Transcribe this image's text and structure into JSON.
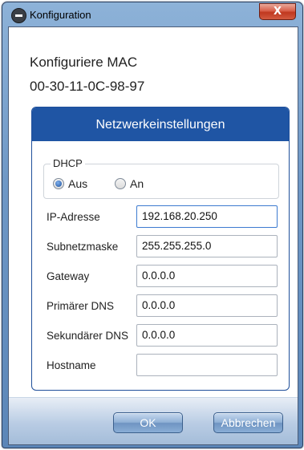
{
  "window": {
    "title": "Konfiguration",
    "close_glyph": "X"
  },
  "header": {
    "line1": "Konfiguriere MAC",
    "mac": "00-30-11-0C-98-97"
  },
  "panel": {
    "title": "Netzwerkeinstellungen",
    "dhcp": {
      "legend": "DHCP",
      "options": [
        {
          "label": "Aus",
          "selected": true
        },
        {
          "label": "An",
          "selected": false
        }
      ]
    },
    "fields": [
      {
        "label": "IP-Adresse",
        "value": "192.168.20.250"
      },
      {
        "label": "Subnetzmaske",
        "value": "255.255.255.0"
      },
      {
        "label": "Gateway",
        "value": "0.0.0.0"
      },
      {
        "label": "Primärer DNS",
        "value": "0.0.0.0"
      },
      {
        "label": "Sekundärer DNS",
        "value": "0.0.0.0"
      },
      {
        "label": "Hostname",
        "value": ""
      }
    ]
  },
  "buttons": {
    "ok": "OK",
    "cancel": "Abbrechen"
  },
  "colors": {
    "panel_header": "#1f55a4",
    "close_button": "#c0381f",
    "button": "#8fb0d6"
  },
  "icons": {
    "app": "app-logo-icon",
    "close": "close-icon"
  }
}
